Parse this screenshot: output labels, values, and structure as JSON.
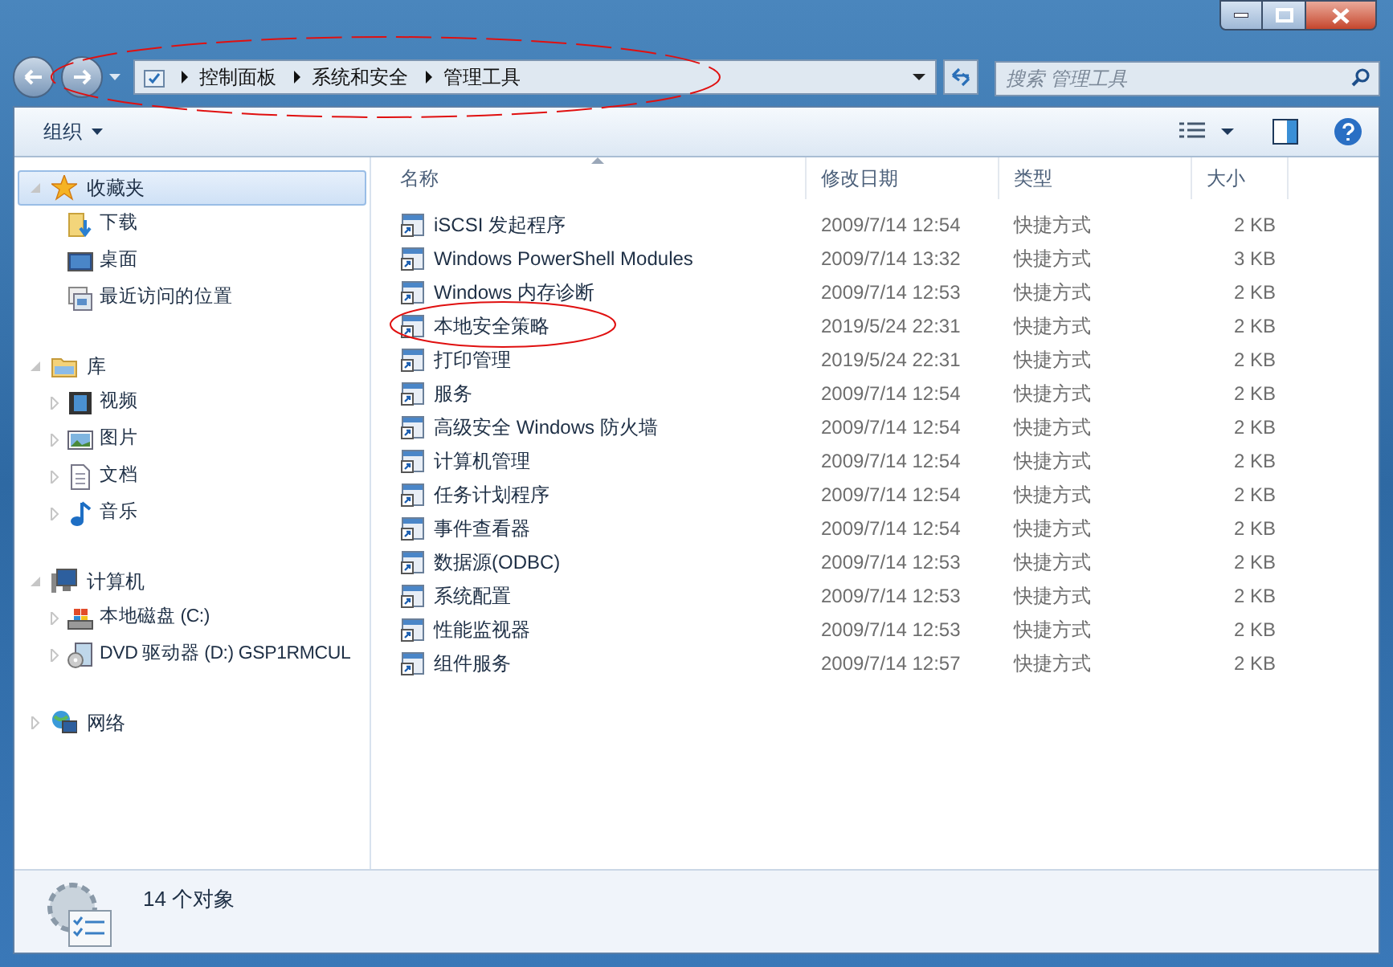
{
  "address_bar": {
    "segments": [
      "控制面板",
      "系统和安全",
      "管理工具"
    ],
    "circled": true
  },
  "search": {
    "placeholder": "搜索 管理工具"
  },
  "toolbar": {
    "organize": "组织"
  },
  "sidebar": {
    "groups": [
      {
        "label": "收藏夹",
        "kind": "star",
        "expanded": true,
        "selected": true,
        "children": [
          {
            "label": "下载",
            "kind": "download"
          },
          {
            "label": "桌面",
            "kind": "desktop"
          },
          {
            "label": "最近访问的位置",
            "kind": "recent"
          }
        ]
      },
      {
        "label": "库",
        "kind": "library",
        "expanded": true,
        "selected": false,
        "children": [
          {
            "label": "视频",
            "kind": "video",
            "expanded": false
          },
          {
            "label": "图片",
            "kind": "picture",
            "expanded": false
          },
          {
            "label": "文档",
            "kind": "document",
            "expanded": false
          },
          {
            "label": "音乐",
            "kind": "music",
            "expanded": false
          }
        ]
      },
      {
        "label": "计算机",
        "kind": "computer",
        "expanded": true,
        "selected": false,
        "children": [
          {
            "label": "本地磁盘 (C:)",
            "kind": "drive",
            "expanded": false
          },
          {
            "label": "DVD 驱动器 (D:) GSP1RMCUL",
            "kind": "dvd",
            "expanded": false
          }
        ]
      },
      {
        "label": "网络",
        "kind": "network",
        "expanded": false,
        "selected": false
      }
    ]
  },
  "table": {
    "columns": [
      "名称",
      "修改日期",
      "类型",
      "大小"
    ],
    "rows": [
      {
        "name": "iSCSI 发起程序",
        "date": "2009/7/14 12:54",
        "type": "快捷方式",
        "size": "2 KB",
        "circled": false
      },
      {
        "name": "Windows PowerShell Modules",
        "date": "2009/7/14 13:32",
        "type": "快捷方式",
        "size": "3 KB",
        "circled": false
      },
      {
        "name": "Windows 内存诊断",
        "date": "2009/7/14 12:53",
        "type": "快捷方式",
        "size": "2 KB",
        "circled": false
      },
      {
        "name": "本地安全策略",
        "date": "2019/5/24 22:31",
        "type": "快捷方式",
        "size": "2 KB",
        "circled": true
      },
      {
        "name": "打印管理",
        "date": "2019/5/24 22:31",
        "type": "快捷方式",
        "size": "2 KB",
        "circled": false
      },
      {
        "name": "服务",
        "date": "2009/7/14 12:54",
        "type": "快捷方式",
        "size": "2 KB",
        "circled": false
      },
      {
        "name": "高级安全 Windows 防火墙",
        "date": "2009/7/14 12:54",
        "type": "快捷方式",
        "size": "2 KB",
        "circled": false
      },
      {
        "name": "计算机管理",
        "date": "2009/7/14 12:54",
        "type": "快捷方式",
        "size": "2 KB",
        "circled": false
      },
      {
        "name": "任务计划程序",
        "date": "2009/7/14 12:54",
        "type": "快捷方式",
        "size": "2 KB",
        "circled": false
      },
      {
        "name": "事件查看器",
        "date": "2009/7/14 12:54",
        "type": "快捷方式",
        "size": "2 KB",
        "circled": false
      },
      {
        "name": "数据源(ODBC)",
        "date": "2009/7/14 12:53",
        "type": "快捷方式",
        "size": "2 KB",
        "circled": false
      },
      {
        "name": "系统配置",
        "date": "2009/7/14 12:53",
        "type": "快捷方式",
        "size": "2 KB",
        "circled": false
      },
      {
        "name": "性能监视器",
        "date": "2009/7/14 12:53",
        "type": "快捷方式",
        "size": "2 KB",
        "circled": false
      },
      {
        "name": "组件服务",
        "date": "2009/7/14 12:57",
        "type": "快捷方式",
        "size": "2 KB",
        "circled": false
      }
    ]
  },
  "status_bar": {
    "text": "14 个对象"
  }
}
